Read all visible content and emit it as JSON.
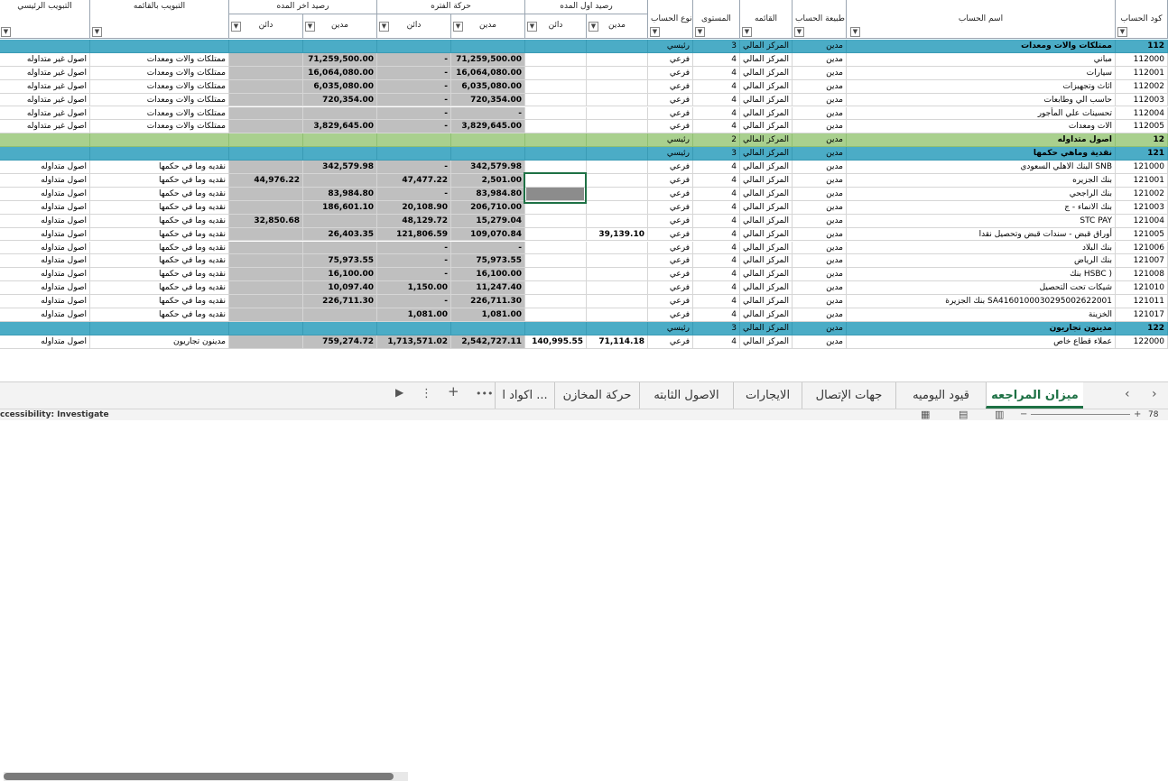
{
  "headers": {
    "main_class": "التبويب الرئيسي",
    "list_class": "التبويب بالقائمه",
    "closing_balance": "رصيد اخر المده",
    "period_movement": "حركة الفتره",
    "opening_balance": "رصيد اول المده",
    "credit": "دائن",
    "debit": "مدين",
    "account_type": "نوع الحساب",
    "level": "المستوى",
    "statement": "القائمه",
    "account_nature": "طبيعة الحساب",
    "account_name": "اسم الحساب",
    "account_code": "كود الحساب"
  },
  "rows": [
    {
      "kind": "blue",
      "code": "112",
      "name": "ممتلكات والات ومعدات",
      "nature": "مدين",
      "stmt": "المركز المالي",
      "level": "3",
      "type": "رئيسي",
      "ob_d": "",
      "ob_c": "",
      "pm_d": "",
      "pm_c": "",
      "cb_d": "",
      "cb_c": "",
      "list": "",
      "main": ""
    },
    {
      "kind": "data",
      "code": "112000",
      "name": "مباني",
      "nature": "مدين",
      "stmt": "المركز المالي",
      "level": "4",
      "type": "فرعي",
      "ob_d": "",
      "ob_c": "",
      "pm_d": "71,259,500.00",
      "pm_c": "-",
      "cb_d": "71,259,500.00",
      "cb_c": "",
      "list": "ممتلكات والات ومعدات",
      "main": "اصول غير متداوله"
    },
    {
      "kind": "data",
      "code": "112001",
      "name": "سيارات",
      "nature": "مدين",
      "stmt": "المركز المالي",
      "level": "4",
      "type": "فرعي",
      "ob_d": "",
      "ob_c": "",
      "pm_d": "16,064,080.00",
      "pm_c": "-",
      "cb_d": "16,064,080.00",
      "cb_c": "",
      "list": "ممتلكات والات ومعدات",
      "main": "اصول غير متداوله"
    },
    {
      "kind": "data",
      "code": "112002",
      "name": "اثاث وتجهيزات",
      "nature": "مدين",
      "stmt": "المركز المالي",
      "level": "4",
      "type": "فرعي",
      "ob_d": "",
      "ob_c": "",
      "pm_d": "6,035,080.00",
      "pm_c": "-",
      "cb_d": "6,035,080.00",
      "cb_c": "",
      "list": "ممتلكات والات ومعدات",
      "main": "اصول غير متداوله"
    },
    {
      "kind": "data",
      "code": "112003",
      "name": "حاسب الي وطابعات",
      "nature": "مدين",
      "stmt": "المركز المالي",
      "level": "4",
      "type": "فرعي",
      "ob_d": "",
      "ob_c": "",
      "pm_d": "720,354.00",
      "pm_c": "-",
      "cb_d": "720,354.00",
      "cb_c": "",
      "list": "ممتلكات والات ومعدات",
      "main": "اصول غير متداوله"
    },
    {
      "kind": "data",
      "code": "112004",
      "name": "تحسينات علي المأجور",
      "nature": "مدين",
      "stmt": "المركز المالي",
      "level": "4",
      "type": "فرعي",
      "ob_d": "",
      "ob_c": "",
      "pm_d": "-",
      "pm_c": "-",
      "cb_d": "",
      "cb_c": "",
      "list": "ممتلكات والات ومعدات",
      "main": "اصول غير متداوله"
    },
    {
      "kind": "data",
      "code": "112005",
      "name": "الات ومعدات",
      "nature": "مدين",
      "stmt": "المركز المالي",
      "level": "4",
      "type": "فرعي",
      "ob_d": "",
      "ob_c": "",
      "pm_d": "3,829,645.00",
      "pm_c": "-",
      "cb_d": "3,829,645.00",
      "cb_c": "",
      "list": "ممتلكات والات ومعدات",
      "main": "اصول غير متداوله"
    },
    {
      "kind": "green",
      "code": "12",
      "name": "اصول متداوله",
      "nature": "مدين",
      "stmt": "المركز المالي",
      "level": "2",
      "type": "رئيسي",
      "ob_d": "",
      "ob_c": "",
      "pm_d": "",
      "pm_c": "",
      "cb_d": "",
      "cb_c": "",
      "list": "",
      "main": ""
    },
    {
      "kind": "blue",
      "code": "121",
      "name": "نقدية وماهي حكمها",
      "nature": "مدين",
      "stmt": "المركز المالي",
      "level": "3",
      "type": "رئيسي",
      "ob_d": "",
      "ob_c": "",
      "pm_d": "",
      "pm_c": "",
      "cb_d": "",
      "cb_c": "",
      "list": "",
      "main": ""
    },
    {
      "kind": "data",
      "code": "121000",
      "name": "البنك الاهلي السعودي SNB",
      "nature": "مدين",
      "stmt": "المركز المالي",
      "level": "4",
      "type": "فرعي",
      "ob_d": "",
      "ob_c": "",
      "pm_d": "342,579.98",
      "pm_c": "-",
      "cb_d": "342,579.98",
      "cb_c": "",
      "list": "نقديه وما في حكمها",
      "main": "اصول متداوله"
    },
    {
      "kind": "data",
      "code": "121001",
      "name": "بنك الجزيره",
      "nature": "مدين",
      "stmt": "المركز المالي",
      "level": "4",
      "type": "فرعي",
      "ob_d": "",
      "ob_c": "",
      "pm_d": "2,501.00",
      "pm_c": "47,477.22",
      "cb_d": "",
      "cb_c": "44,976.22",
      "list": "نقديه وما في حكمها",
      "main": "اصول متداوله"
    },
    {
      "kind": "data",
      "code": "121002",
      "name": "بنك الراجحي",
      "nature": "مدين",
      "stmt": "المركز المالي",
      "level": "4",
      "type": "فرعي",
      "ob_d": "",
      "ob_c": "",
      "pm_d": "83,984.80",
      "pm_c": "-",
      "cb_d": "83,984.80",
      "cb_c": "",
      "list": "نقديه وما في حكمها",
      "main": "اصول متداوله"
    },
    {
      "kind": "data",
      "code": "121003",
      "name": "بنك الانماء - ج",
      "nature": "مدين",
      "stmt": "المركز المالي",
      "level": "4",
      "type": "فرعي",
      "ob_d": "",
      "ob_c": "",
      "pm_d": "206,710.00",
      "pm_c": "20,108.90",
      "cb_d": "186,601.10",
      "cb_c": "",
      "list": "نقديه وما في حكمها",
      "main": "اصول متداوله"
    },
    {
      "kind": "data",
      "code": "121004",
      "name": "STC PAY",
      "nature": "مدين",
      "stmt": "المركز المالي",
      "level": "4",
      "type": "فرعي",
      "ob_d": "",
      "ob_c": "",
      "pm_d": "15,279.04",
      "pm_c": "48,129.72",
      "cb_d": "",
      "cb_c": "32,850.68",
      "list": "نقديه وما في حكمها",
      "main": "اصول متداوله"
    },
    {
      "kind": "data",
      "code": "121005",
      "name": "أوراق قبض - سندات قبض وتحصيل نقدا",
      "nature": "مدين",
      "stmt": "المركز المالي",
      "level": "4",
      "type": "فرعي",
      "ob_d": "39,139.10",
      "ob_c": "",
      "pm_d": "109,070.84",
      "pm_c": "121,806.59",
      "cb_d": "26,403.35",
      "cb_c": "",
      "list": "نقديه وما في حكمها",
      "main": "اصول متداوله"
    },
    {
      "kind": "data",
      "code": "121006",
      "name": "بنك البلاد",
      "nature": "مدين",
      "stmt": "المركز المالي",
      "level": "4",
      "type": "فرعي",
      "ob_d": "",
      "ob_c": "",
      "pm_d": "-",
      "pm_c": "-",
      "cb_d": "",
      "cb_c": "",
      "list": "نقديه وما في حكمها",
      "main": "اصول متداوله"
    },
    {
      "kind": "data",
      "code": "121007",
      "name": "بنك الرياض",
      "nature": "مدين",
      "stmt": "المركز المالي",
      "level": "4",
      "type": "فرعي",
      "ob_d": "",
      "ob_c": "",
      "pm_d": "75,973.55",
      "pm_c": "-",
      "cb_d": "75,973.55",
      "cb_c": "",
      "list": "نقديه وما في حكمها",
      "main": "اصول متداوله"
    },
    {
      "kind": "data",
      "code": "121008",
      "name": "بنك HSBC )",
      "nature": "مدين",
      "stmt": "المركز المالي",
      "level": "4",
      "type": "فرعي",
      "ob_d": "",
      "ob_c": "",
      "pm_d": "16,100.00",
      "pm_c": "-",
      "cb_d": "16,100.00",
      "cb_c": "",
      "list": "نقديه وما في حكمها",
      "main": "اصول متداوله"
    },
    {
      "kind": "data",
      "code": "121010",
      "name": "شيكات تحت التحصيل",
      "nature": "مدين",
      "stmt": "المركز المالي",
      "level": "4",
      "type": "فرعي",
      "ob_d": "",
      "ob_c": "",
      "pm_d": "11,247.40",
      "pm_c": "1,150.00",
      "cb_d": "10,097.40",
      "cb_c": "",
      "list": "نقديه وما في حكمها",
      "main": "اصول متداوله"
    },
    {
      "kind": "data",
      "code": "121011",
      "name": "بنك الجزيرة SA4160100030295002622001",
      "nature": "مدين",
      "stmt": "المركز المالي",
      "level": "4",
      "type": "فرعي",
      "ob_d": "",
      "ob_c": "",
      "pm_d": "226,711.30",
      "pm_c": "-",
      "cb_d": "226,711.30",
      "cb_c": "",
      "list": "نقديه وما في حكمها",
      "main": "اصول متداوله"
    },
    {
      "kind": "data",
      "code": "121017",
      "name": "الخزينة",
      "nature": "مدين",
      "stmt": "المركز المالي",
      "level": "4",
      "type": "فرعي",
      "ob_d": "",
      "ob_c": "",
      "pm_d": "1,081.00",
      "pm_c": "1,081.00",
      "cb_d": "",
      "cb_c": "",
      "list": "نقديه وما في حكمها",
      "main": "اصول متداوله"
    },
    {
      "kind": "blue",
      "code": "122",
      "name": "مدينون تجاريون",
      "nature": "مدين",
      "stmt": "المركز المالي",
      "level": "3",
      "type": "رئيسي",
      "ob_d": "",
      "ob_c": "",
      "pm_d": "",
      "pm_c": "",
      "cb_d": "",
      "cb_c": "",
      "list": "",
      "main": ""
    },
    {
      "kind": "data",
      "code": "122000",
      "name": "عملاء قطاع خاص",
      "nature": "مدين",
      "stmt": "المركز المالي",
      "level": "4",
      "type": "فرعي",
      "ob_d": "71,114.18",
      "ob_c": "140,995.55",
      "pm_d": "2,542,727.11",
      "pm_c": "1,713,571.02",
      "cb_d": "759,274.72",
      "cb_c": "",
      "list": "مدينون تجاريون",
      "main": "اصول متداوله"
    }
  ],
  "tabs": [
    "ميزان المراجعه",
    "قيود اليوميه",
    "جهات الإتصال",
    "الايجارات",
    "الاصول الثابته",
    "حركة المخازن",
    "اكواد ا ..."
  ],
  "tab_add": "+",
  "tab_more": "⋮",
  "tab_dots": "•••",
  "status": {
    "accessibility": "ccessibility: Investigate",
    "zoom": "78"
  },
  "colors": {
    "band_blue": "#4bacc6",
    "band_green": "#a9d08e",
    "gray_fill": "#bfbfbf",
    "accent": "#1e7145"
  }
}
